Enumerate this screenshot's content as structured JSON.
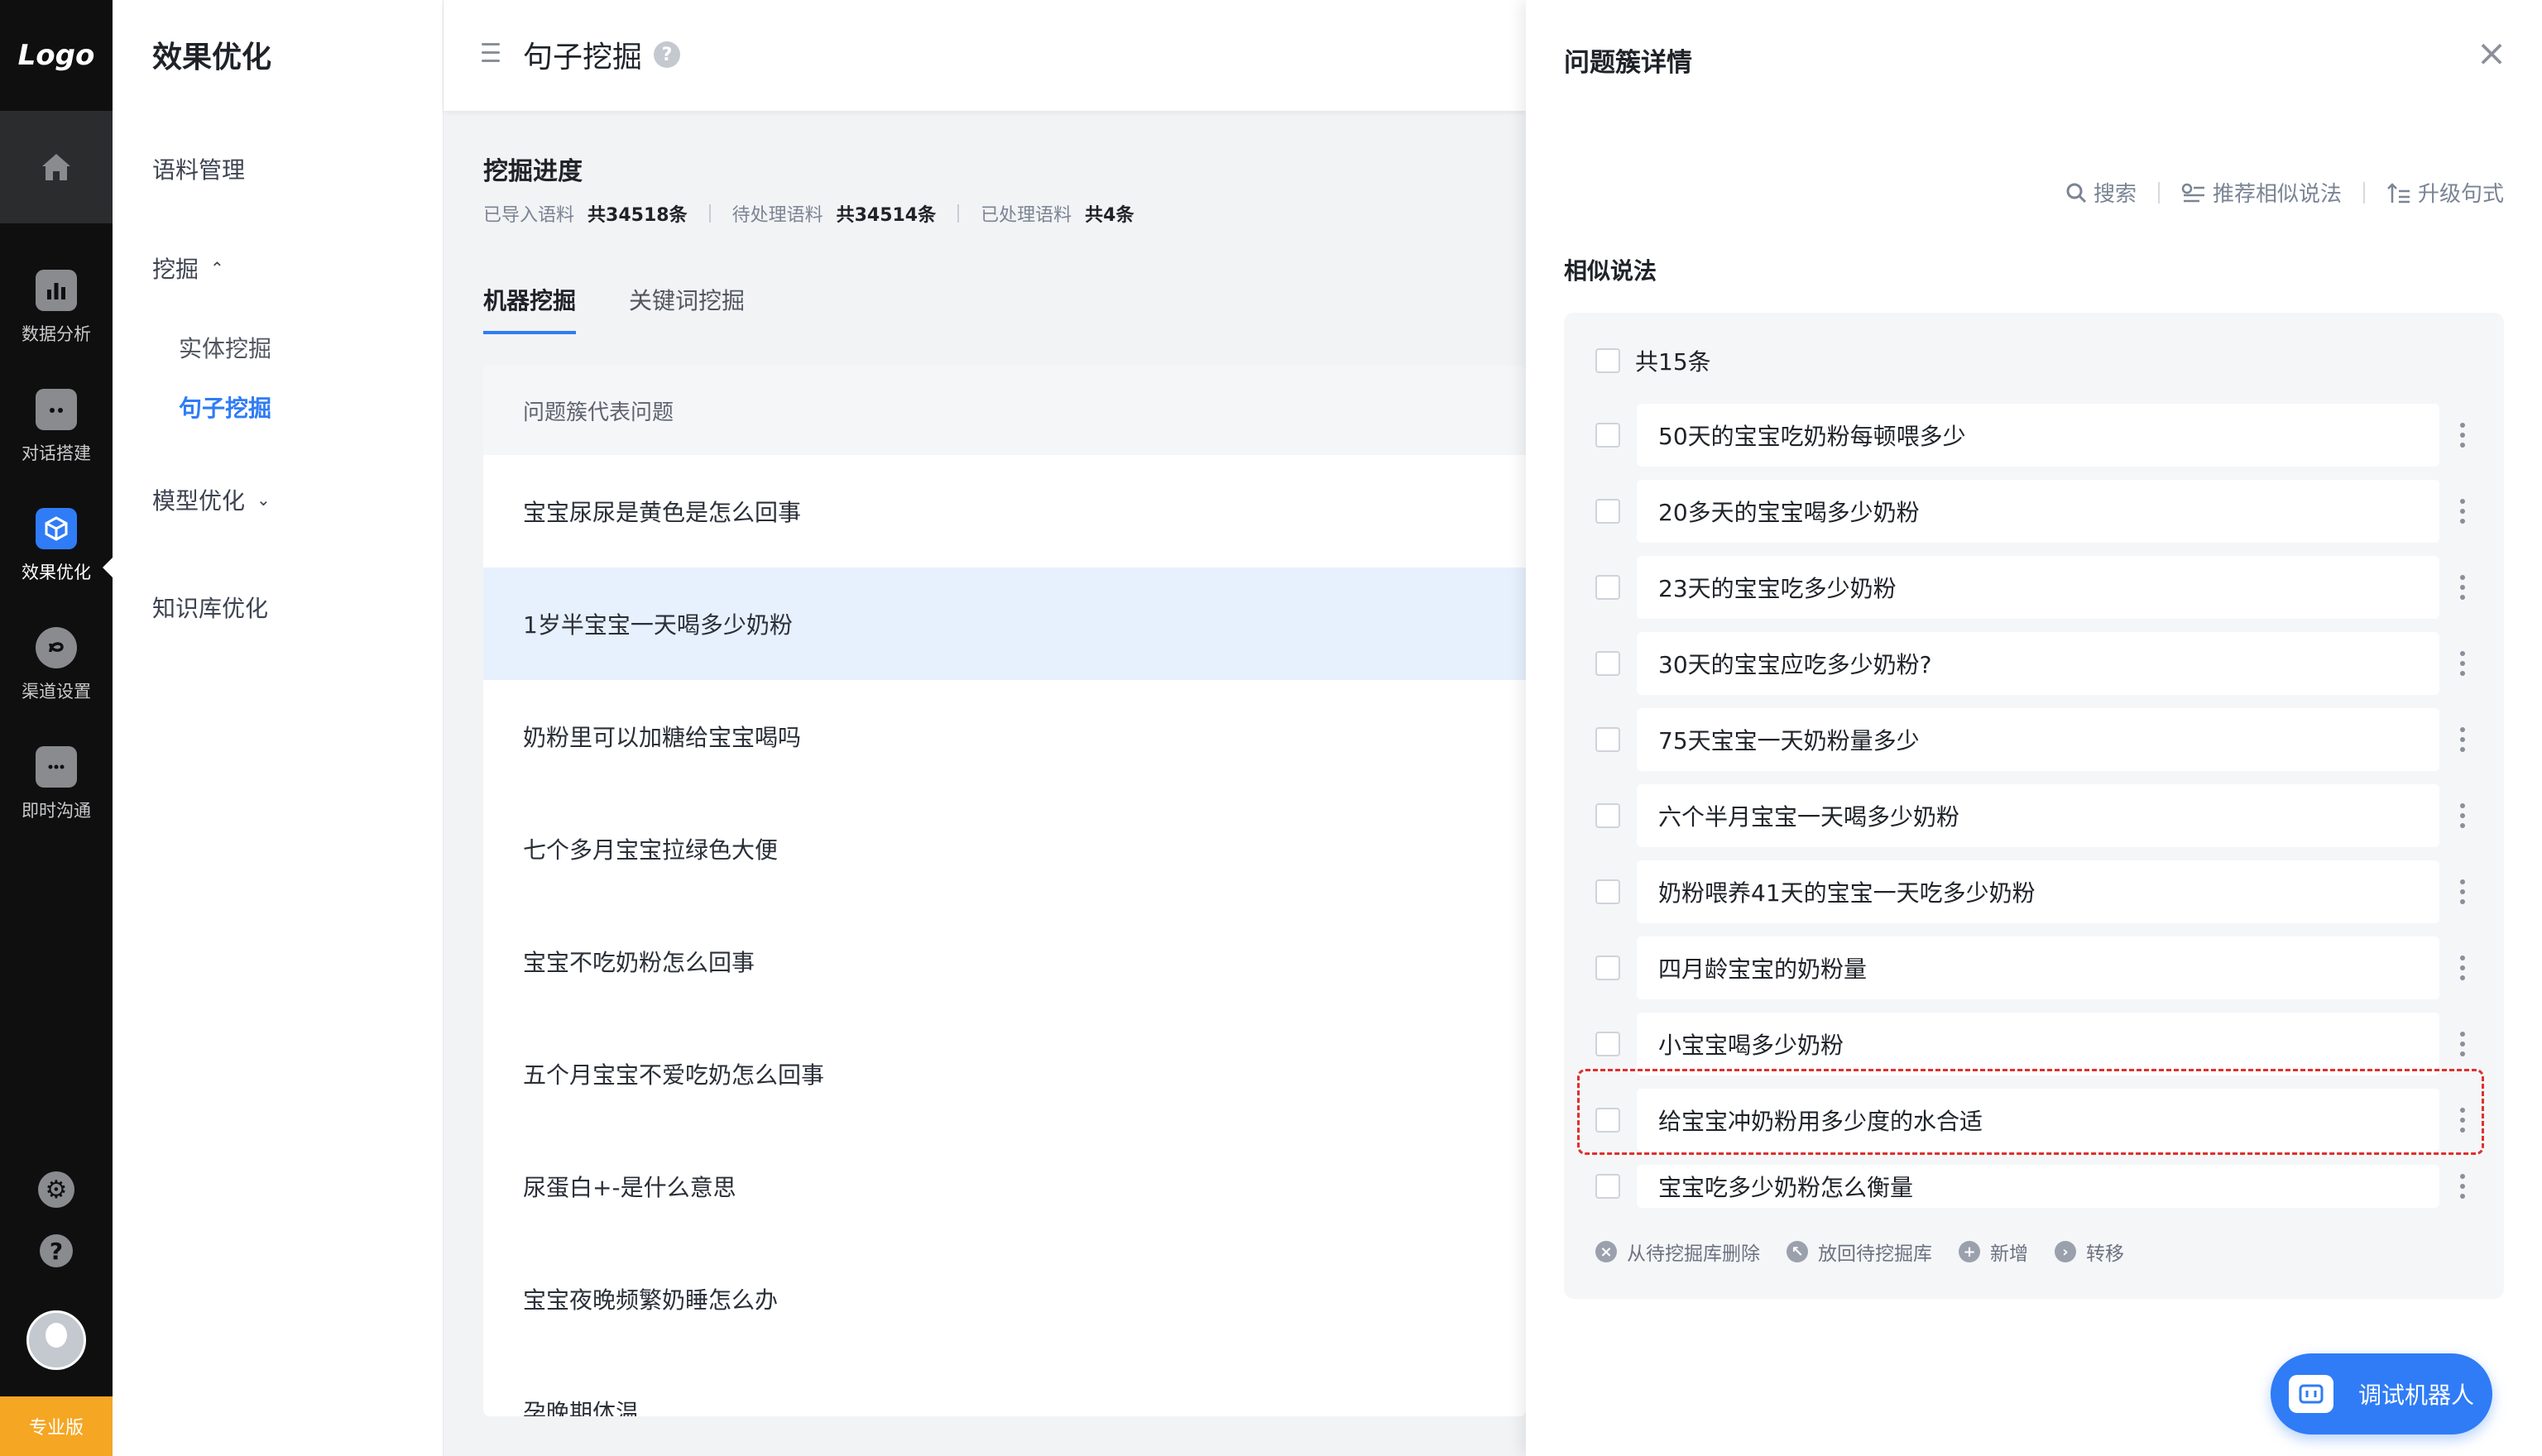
{
  "nav": {
    "logo": "Logo",
    "home_icon": "home-icon",
    "items": [
      {
        "label": "数据分析",
        "icon": "bar-chart-icon"
      },
      {
        "label": "对话搭建",
        "icon": "robot-icon"
      },
      {
        "label": "效果优化",
        "icon": "cube-icon"
      },
      {
        "label": "渠道设置",
        "icon": "channel-icon"
      },
      {
        "label": "即时沟通",
        "icon": "chat-icon"
      }
    ],
    "pro_label": "专业版"
  },
  "sidebar": {
    "title": "效果优化",
    "items": {
      "corpus": "语料管理",
      "mining": "挖掘",
      "entity": "实体挖掘",
      "sentence": "句子挖掘",
      "model": "模型优化",
      "kb": "知识库优化"
    }
  },
  "header": {
    "title": "句子挖掘"
  },
  "progress": {
    "title": "挖掘进度",
    "imported_label": "已导入语料",
    "imported_value": "共34518条",
    "pending_label": "待处理语料",
    "pending_value": "共34514条",
    "processed_label": "已处理语料",
    "processed_value": "共4条"
  },
  "tabs": [
    "机器挖掘",
    "关键词挖掘"
  ],
  "table": {
    "header": "问题簇代表问题",
    "rows": [
      "宝宝尿尿是黄色是怎么回事",
      "1岁半宝宝一天喝多少奶粉",
      "奶粉里可以加糖给宝宝喝吗",
      "七个多月宝宝拉绿色大便",
      "宝宝不吃奶粉怎么回事",
      "五个月宝宝不爱吃奶怎么回事",
      "尿蛋白+-是什么意思",
      "宝宝夜晚频繁奶睡怎么办",
      "孕晚期体温"
    ]
  },
  "panel": {
    "title": "问题簇详情",
    "actions": {
      "search": "搜索",
      "recommend": "推荐相似说法",
      "upgrade": "升级句式"
    },
    "similar_title": "相似说法",
    "total": "共15条",
    "items": [
      "50天的宝宝吃奶粉每顿喂多少",
      "20多天的宝宝喝多少奶粉",
      "23天的宝宝吃多少奶粉",
      "30天的宝宝应吃多少奶粉?",
      "75天宝宝一天奶粉量多少",
      "六个半月宝宝一天喝多少奶粉",
      "奶粉喂养41天的宝宝一天吃多少奶粉",
      "四月龄宝宝的奶粉量",
      "小宝宝喝多少奶粉",
      "给宝宝冲奶粉用多少度的水合适",
      "宝宝吃多少奶粉怎么衡量"
    ],
    "bottom_actions": {
      "delete": "从待挖掘库删除",
      "return": "放回待挖掘库",
      "add": "新增",
      "transfer": "转移"
    },
    "robot_button": "调试机器人"
  },
  "colors": {
    "accent": "#2f7cf6",
    "highlight_border": "#e0302c",
    "pro_badge": "#f5a623"
  }
}
